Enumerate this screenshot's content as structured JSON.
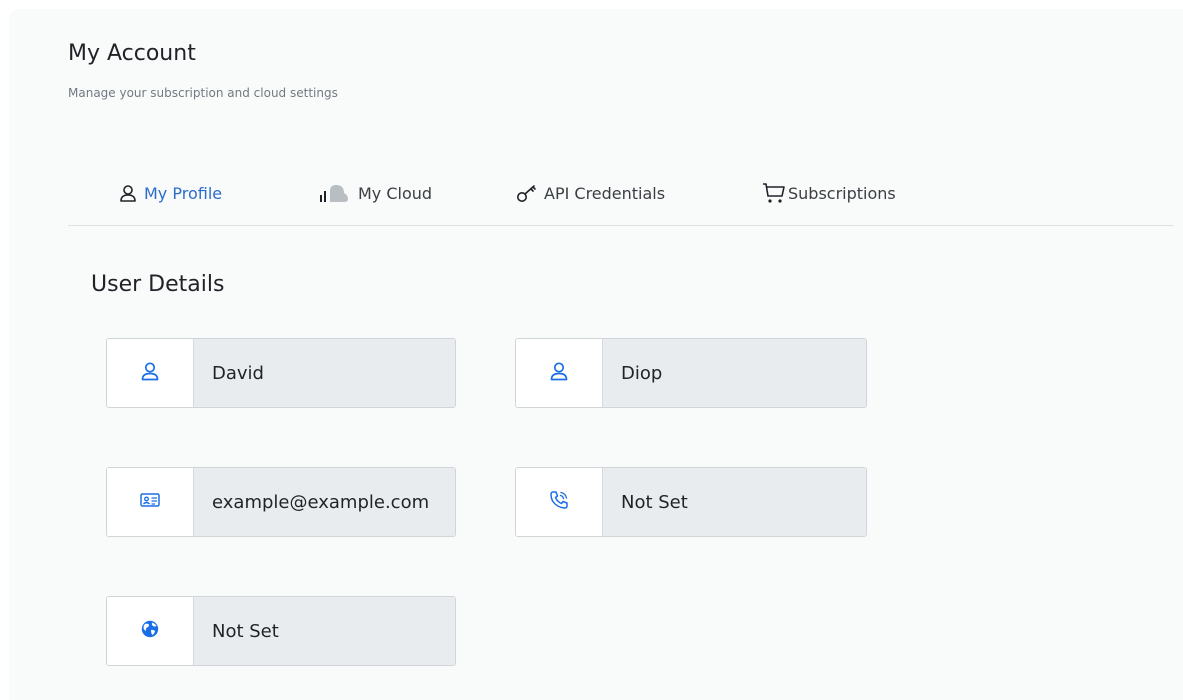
{
  "header": {
    "title": "My Account",
    "subtitle": "Manage your subscription and cloud settings"
  },
  "tabs": [
    {
      "label": "My Profile",
      "icon": "user-icon",
      "active": true
    },
    {
      "label": "My Cloud",
      "icon": "cloud-chart-icon",
      "active": false
    },
    {
      "label": "API Credentials",
      "icon": "key-icon",
      "active": false
    },
    {
      "label": "Subscriptions",
      "icon": "cart-icon",
      "active": false
    }
  ],
  "user_details": {
    "title": "User Details",
    "first_name": {
      "value": "David",
      "icon": "user-icon"
    },
    "last_name": {
      "value": "Diop",
      "icon": "user-icon"
    },
    "email": {
      "value": "example@example.com",
      "icon": "id-card-icon"
    },
    "phone": {
      "value": "Not Set",
      "icon": "phone-icon"
    },
    "country": {
      "value": "Not Set",
      "icon": "globe-icon"
    }
  },
  "colors": {
    "accent": "#2b6dc9",
    "icon_blue": "#1a6fe8",
    "field_bg": "#e9ecef",
    "page_bg": "#f9fafa"
  }
}
